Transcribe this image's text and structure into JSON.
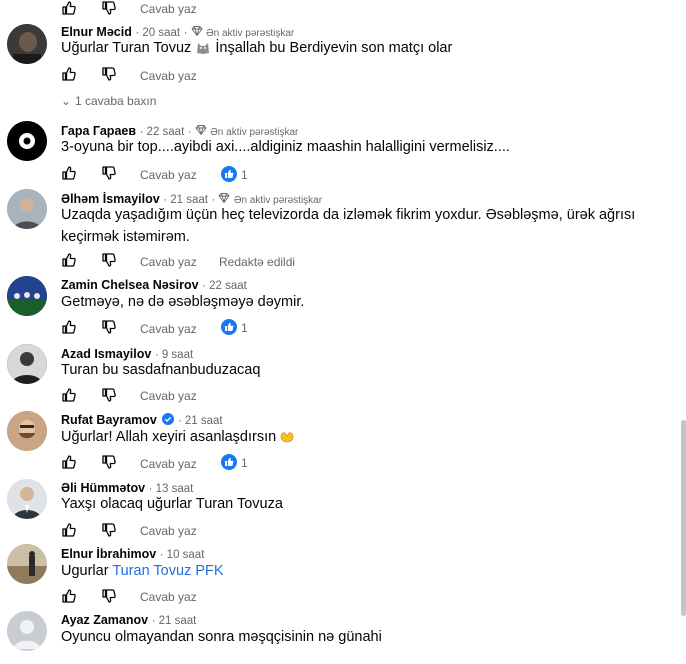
{
  "actions": {
    "reply_label": "Cavab yaz"
  },
  "top_partial": {
    "reply_label": "Cavab yaz"
  },
  "comments": [
    {
      "name": "Elnur Məcid",
      "time": "20 saat",
      "badge": "Ən aktiv pərəstişkar",
      "text": "Uğurlar Turan Tovuz",
      "text_after": "İnşallah bu Berdiyevin son matçı olar",
      "more_replies": "1 cavaba baxın"
    },
    {
      "name": "Гара Гараев",
      "time": "22 saat",
      "badge": "Ən aktiv pərəstişkar",
      "text": "3-oyuna bir top....ayibdi axi....aldiginiz maashin halalligini vermelisiz....",
      "reactions": "1"
    },
    {
      "name": "Əlhəm İsmayilov",
      "time": "21 saat",
      "badge": "Ən aktiv pərəstişkar",
      "text_line1": "Uzaqda yaşadığım üçün heç televizorda da izləmək fikrim yoxdur. Əsəbləşmə, ürək ağrısı",
      "text_line2": "keçirmək istəmirəm.",
      "edited": "Redaktə edildi"
    },
    {
      "name": "Zamin Chelsea Nəsirov",
      "time": "22 saat",
      "text": "Getməyə, nə də əsəbləşməyə dəymir.",
      "reactions": "1"
    },
    {
      "name": "Azad Ismayilov",
      "time": "9 saat",
      "text": "Turan bu sasdafnanbuduzacaq"
    },
    {
      "name": "Rufat Bayramov",
      "time": "21 saat",
      "text": "Uğurlar! Allah xeyiri asanlaşdırsın",
      "reactions": "1"
    },
    {
      "name": "Əli Hümmətov",
      "time": "13 saat",
      "text": "Yaxşı olacaq uğurlar Turan Tovuza"
    },
    {
      "name": "Elnur İbrahimov",
      "time": "10 saat",
      "text": "Ugurlar",
      "link": "Turan Tovuz PFK"
    },
    {
      "name": "Ayaz Zamanov",
      "time": "21 saat",
      "text": "Oyuncu olmayandan sonra məşqçisinin nə günahi"
    }
  ],
  "colors": {
    "like_blue": "#1877f2",
    "meta_gray": "#65676b",
    "link_blue": "#216fdb"
  }
}
